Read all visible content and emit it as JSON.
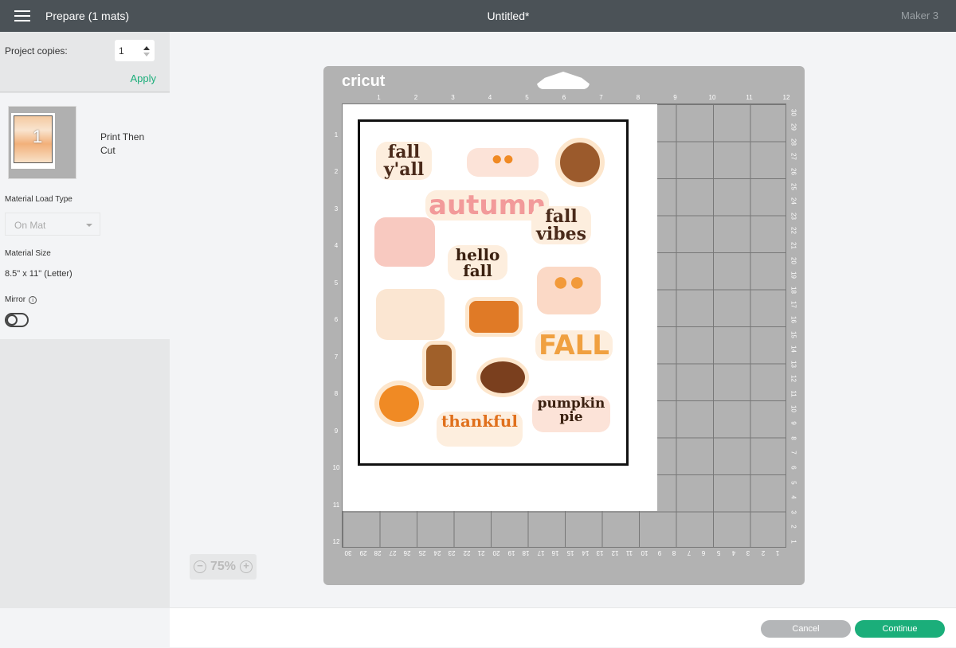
{
  "topbar": {
    "title": "Prepare (1 mats)",
    "document": "Untitled*",
    "machine": "Maker 3"
  },
  "sidebar": {
    "copies_label": "Project copies:",
    "copies_value": "1",
    "apply": "Apply",
    "mat_number": "1",
    "mat_mode": "Print Then Cut",
    "load_type_label": "Material Load Type",
    "load_type_value": "On Mat",
    "size_label": "Material Size",
    "size_value": "8.5\" x 11\" (Letter)",
    "mirror_label": "Mirror",
    "mirror_on": false
  },
  "mat": {
    "logo": "cricut",
    "top_ruler": [
      "1",
      "2",
      "3",
      "4",
      "5",
      "6",
      "7",
      "8",
      "9",
      "10",
      "11",
      "12"
    ],
    "left_ruler": [
      "1",
      "2",
      "3",
      "4",
      "5",
      "6",
      "7",
      "8",
      "9",
      "10",
      "11",
      "12"
    ],
    "right_ruler": [
      "30",
      "29",
      "28",
      "27",
      "26",
      "25",
      "24",
      "23",
      "22",
      "21",
      "20",
      "19",
      "18",
      "17",
      "16",
      "15",
      "14",
      "13",
      "12",
      "11",
      "10",
      "9",
      "8",
      "7",
      "6",
      "5",
      "4",
      "3",
      "2",
      "1"
    ],
    "bottom_ruler": [
      "30",
      "29",
      "28",
      "27",
      "26",
      "25",
      "24",
      "23",
      "22",
      "21",
      "20",
      "19",
      "18",
      "17",
      "16",
      "15",
      "14",
      "13",
      "12",
      "11",
      "10",
      "9",
      "8",
      "7",
      "6",
      "5",
      "4",
      "3",
      "2",
      "1"
    ],
    "stickers": [
      "fall y'all",
      "autumn",
      "fall vibes",
      "hello fall",
      "FALL",
      "thankful",
      "pumpkin pie"
    ]
  },
  "zoom": {
    "level": "75%",
    "minus": "−",
    "plus": "+"
  },
  "footer": {
    "cancel": "Cancel",
    "continue": "Continue"
  },
  "colors": {
    "accent": "#1bae7a",
    "topbar": "#4b5257",
    "mat": "#b2b2b2"
  }
}
